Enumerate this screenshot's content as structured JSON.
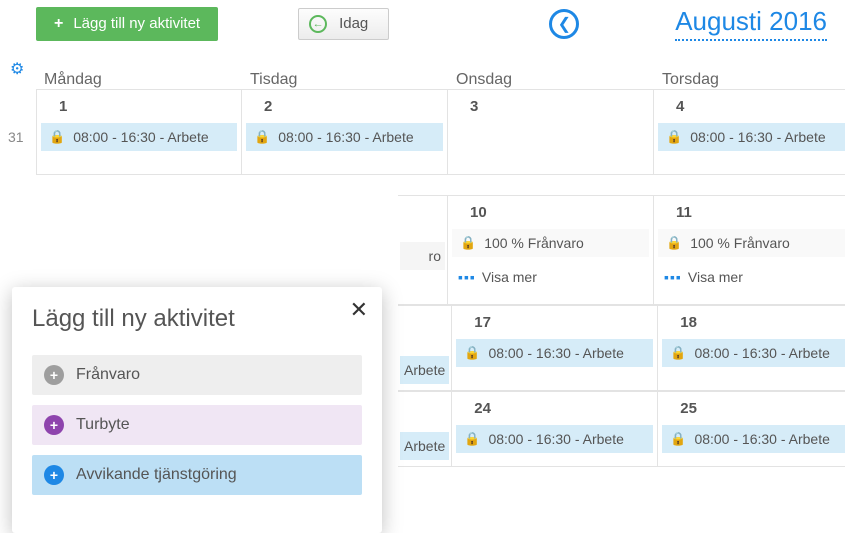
{
  "toolbar": {
    "add_label": "Lägg till ny aktivitet",
    "today_label": "Idag",
    "month_title": "Augusti 2016"
  },
  "weekdays": {
    "mon": "Måndag",
    "tue": "Tisdag",
    "wed": "Onsdag",
    "thu": "Torsdag"
  },
  "week_num": "31",
  "rows": [
    {
      "mon": {
        "day": "1",
        "entry": "08:00 - 16:30 - Arbete"
      },
      "tue": {
        "day": "2",
        "entry": "08:00 - 16:30 - Arbete"
      },
      "wed": {
        "day": "3"
      },
      "thu": {
        "day": "4",
        "entry": "08:00 - 16:30 - Arbete"
      }
    },
    {
      "frag": "ro",
      "wed": {
        "day": "10",
        "entry": "100 %  Frånvaro",
        "more": "Visa mer"
      },
      "thu": {
        "day": "11",
        "entry": "100 %  Frånvaro",
        "more": "Visa mer"
      }
    },
    {
      "frag": "Arbete",
      "wed": {
        "day": "17",
        "entry": "08:00 - 16:30 - Arbete"
      },
      "thu": {
        "day": "18",
        "entry": "08:00 - 16:30 - Arbete"
      }
    },
    {
      "frag": "Arbete",
      "wed": {
        "day": "24",
        "entry": "08:00 - 16:30 - Arbete"
      },
      "thu": {
        "day": "25",
        "entry": "08:00 - 16:30 - Arbete"
      }
    }
  ],
  "popover": {
    "title": "Lägg till ny aktivitet",
    "opt1": "Frånvaro",
    "opt2": "Turbyte",
    "opt3": "Avvikande tjänstgöring"
  }
}
